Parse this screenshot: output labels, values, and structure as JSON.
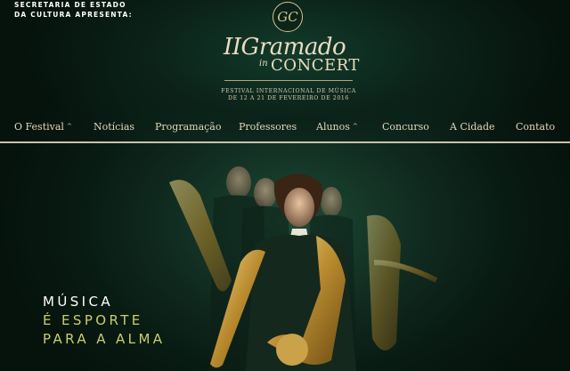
{
  "presenter": {
    "line1": "SECRETARIA DE ESTADO",
    "line2": "DA CULTURA APRESENTA:"
  },
  "logo": {
    "monogram": "GC",
    "roman": "II",
    "name": "Gramado",
    "in": "in",
    "concert": "CONCERT",
    "tagline_line1": "FESTIVAL INTERNACIONAL DE MÚSICA",
    "tagline_line2": "DE 12 A 21 DE FEVEREIRO DE 2016"
  },
  "nav": {
    "items": [
      {
        "label": "O Festival",
        "dropdown": true
      },
      {
        "label": "Notícias",
        "dropdown": false
      },
      {
        "label": "Programação",
        "dropdown": false
      },
      {
        "label": "Professores",
        "dropdown": false
      },
      {
        "label": "Alunos",
        "dropdown": true
      },
      {
        "label": "Concurso",
        "dropdown": false
      },
      {
        "label": "A Cidade",
        "dropdown": false
      },
      {
        "label": "Contato",
        "dropdown": false
      }
    ],
    "caret_glyph": "^"
  },
  "hero": {
    "slogan_line1": "MÚSICA",
    "slogan_line2": "É ESPORTE",
    "slogan_line3": "PARA A ALMA",
    "image": "saxophone-ensemble-photo"
  },
  "colors": {
    "background": "#06160f",
    "gold": "#d8c28a",
    "nav_text": "#e3d7bb",
    "slogan_accent": "#c8cf6a"
  }
}
